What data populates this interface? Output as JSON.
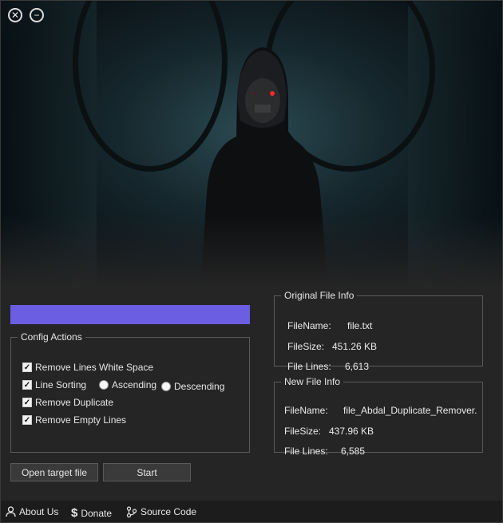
{
  "window": {
    "close_icon": "close-circle-icon",
    "minimize_icon": "minimize-circle-icon"
  },
  "banner": {
    "alt": "dark hooded cyber figure in tunnel"
  },
  "progress": {
    "value_percent": 100,
    "color": "#6c5ee2"
  },
  "config": {
    "legend": "Config Actions",
    "remove_whitespace": {
      "label": "Remove Lines White Space",
      "checked": true
    },
    "line_sorting": {
      "label": "Line Sorting",
      "checked": true
    },
    "ascending": {
      "label": "Ascending",
      "selected": false
    },
    "descending": {
      "label": "Descending",
      "selected": false
    },
    "remove_duplicate": {
      "label": "Remove Duplicate",
      "checked": true
    },
    "remove_empty": {
      "label": "Remove Empty Lines",
      "checked": true
    }
  },
  "original_file": {
    "legend": "Original File Info",
    "filename_label": "FileName:",
    "filename_value": "file.txt",
    "filesize_label": "FileSize:",
    "filesize_value": "451.26 KB",
    "filelines_label": "File Lines:",
    "filelines_value": "6,613"
  },
  "new_file": {
    "legend": "New File Info",
    "filename_label": "FileName:",
    "filename_value": "file_Abdal_Duplicate_Remover.",
    "filesize_label": "FileSize:",
    "filesize_value": "437.96 KB",
    "filelines_label": "File Lines:",
    "filelines_value": "6,585"
  },
  "actions": {
    "open_label": "Open target file",
    "start_label": "Start"
  },
  "footer": {
    "about_label": "About Us",
    "donate_label": "Donate",
    "source_label": "Source Code"
  }
}
